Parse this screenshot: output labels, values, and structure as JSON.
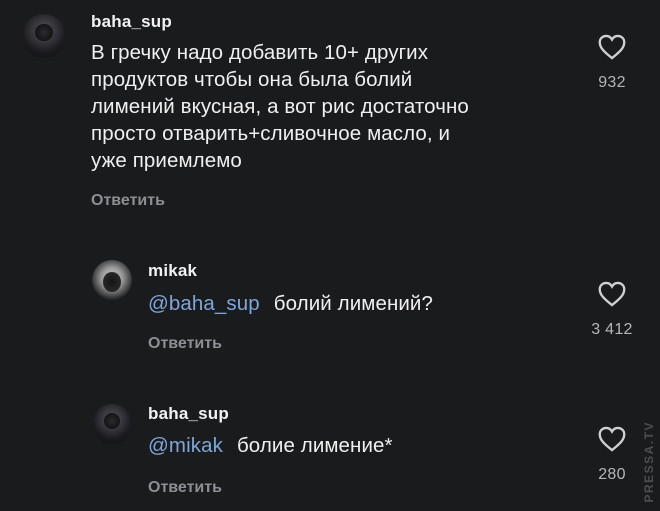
{
  "comments": [
    {
      "username": "baha_sup",
      "mention": "",
      "lines": [
        "В гречку надо добавить 10+ других",
        "продуктов чтобы она была болий",
        "лимений вкусная, а вот рис достаточно",
        "просто отварить+сливочное масло, и",
        "уже приемлемо"
      ],
      "reply_label": "Ответить",
      "likes": "932"
    },
    {
      "username": "mikak",
      "mention": "@baha_sup",
      "text": "болий лимений?",
      "reply_label": "Ответить",
      "likes": "3 412"
    },
    {
      "username": "baha_sup",
      "mention": "@mikak",
      "text": "болие лимение*",
      "reply_label": "Ответить",
      "likes": "280"
    }
  ],
  "watermark": "PRESSA.TV",
  "colors": {
    "background": "#1a1b1d",
    "text": "#f0f0f0",
    "mention": "#7fa6d9",
    "muted": "#8e8e93"
  },
  "icons": {
    "like": "heart-outline-icon"
  }
}
